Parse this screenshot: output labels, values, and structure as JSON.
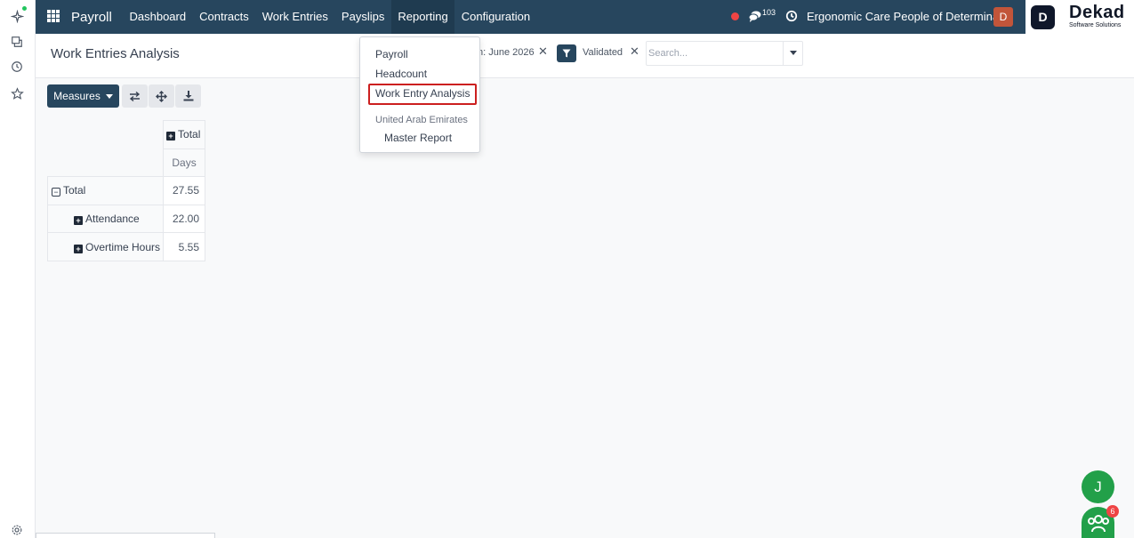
{
  "navbar": {
    "app_name": "Payroll",
    "menu": [
      {
        "label": "Dashboard"
      },
      {
        "label": "Contracts"
      },
      {
        "label": "Work Entries"
      },
      {
        "label": "Payslips"
      },
      {
        "label": "Reporting",
        "active": true
      },
      {
        "label": "Configuration"
      }
    ],
    "chat_count": "103",
    "company": "Ergonomic Care People of Determina...",
    "user_initial": "D",
    "brand": {
      "name": "Dekad",
      "tagline": "Software Solutions"
    },
    "colors": {
      "bar": "#27465e",
      "record_dot": "#ef4444",
      "avatar": "#c2553a"
    }
  },
  "control_panel": {
    "title": "Work Entries Analysis",
    "facets": [
      {
        "text": "n: June 2026"
      },
      {
        "text": "Validated",
        "icon": "filter-icon"
      }
    ],
    "search_placeholder": "Search..."
  },
  "toolbar": {
    "measures_label": "Measures",
    "buttons": [
      "flip-axis-icon",
      "expand-all-icon",
      "download-icon"
    ]
  },
  "pivot": {
    "col_header": "Total",
    "measure": "Days",
    "total_label": "Total",
    "total_value": "27.55",
    "rows": [
      {
        "label": "Attendance",
        "value": "22.00"
      },
      {
        "label": "Overtime Hours",
        "value": "5.55"
      }
    ]
  },
  "reporting_menu": {
    "items": [
      "Payroll",
      "Headcount",
      "Work Entry Analysis"
    ],
    "highlighted": "Work Entry Analysis",
    "section": "United Arab Emirates",
    "section_items": [
      "Master Report"
    ]
  },
  "chat": {
    "user_initial": "J",
    "team_badge": "6",
    "color": "#22a049"
  }
}
